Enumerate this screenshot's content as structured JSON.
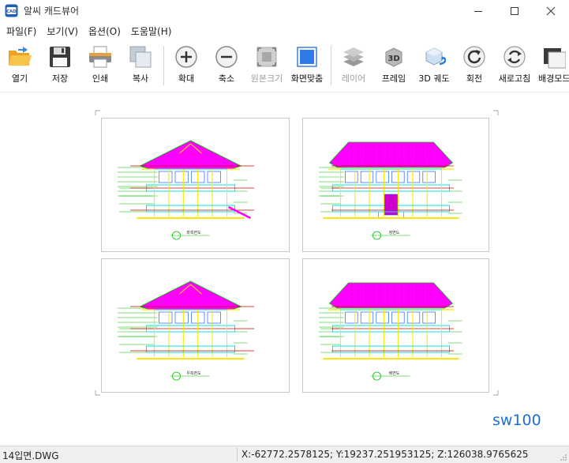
{
  "window": {
    "title": "알씨 캐드뷰어",
    "minimize": "—",
    "maximize": "☐",
    "close": "✕"
  },
  "menu": [
    {
      "label": "파일(F)"
    },
    {
      "label": "보기(V)"
    },
    {
      "label": "옵션(O)"
    },
    {
      "label": "도움말(H)"
    }
  ],
  "toolbar": {
    "buttons": [
      {
        "label": "열기",
        "icon": "folder-open-icon",
        "enabled": true
      },
      {
        "label": "저장",
        "icon": "floppy-disk-icon",
        "enabled": true
      },
      {
        "label": "인쇄",
        "icon": "printer-icon",
        "enabled": true
      },
      {
        "label": "복사",
        "icon": "copy-icon",
        "enabled": true
      },
      {
        "label": "확대",
        "icon": "zoom-in-icon",
        "enabled": true
      },
      {
        "label": "축소",
        "icon": "zoom-out-icon",
        "enabled": true
      },
      {
        "label": "원본크기",
        "icon": "actual-size-icon",
        "enabled": false
      },
      {
        "label": "화면맞춤",
        "icon": "fit-screen-icon",
        "enabled": true
      },
      {
        "label": "레이어",
        "icon": "layers-icon",
        "enabled": false
      },
      {
        "label": "프레임",
        "icon": "frame-3d-icon",
        "enabled": true
      },
      {
        "label": "3D 궤도",
        "icon": "orbit-3d-icon",
        "enabled": true
      },
      {
        "label": "회전",
        "icon": "rotate-icon",
        "enabled": true
      },
      {
        "label": "새로고침",
        "icon": "refresh-icon",
        "enabled": true
      },
      {
        "label": "배경모드",
        "icon": "background-mode-icon",
        "enabled": true
      }
    ]
  },
  "drawing": {
    "sheets": [
      {
        "title": "좌측면도",
        "roof_style": "hip"
      },
      {
        "title": "정면도",
        "roof_style": "long"
      },
      {
        "title": "우측면도",
        "roof_style": "hip"
      },
      {
        "title": "배면도",
        "roof_style": "long"
      }
    ],
    "colors": {
      "roof": "#ff00ff",
      "wall": "#00e5ee",
      "structure": "#ffe600",
      "dimension": "#00c000",
      "floorline": "#cc0000",
      "outline": "#0044ff"
    }
  },
  "watermark": "sw100",
  "status": {
    "filename": "14입면.DWG",
    "coordinates": "X:-62772.2578125; Y:19237.251953125; Z:126038.9765625"
  }
}
